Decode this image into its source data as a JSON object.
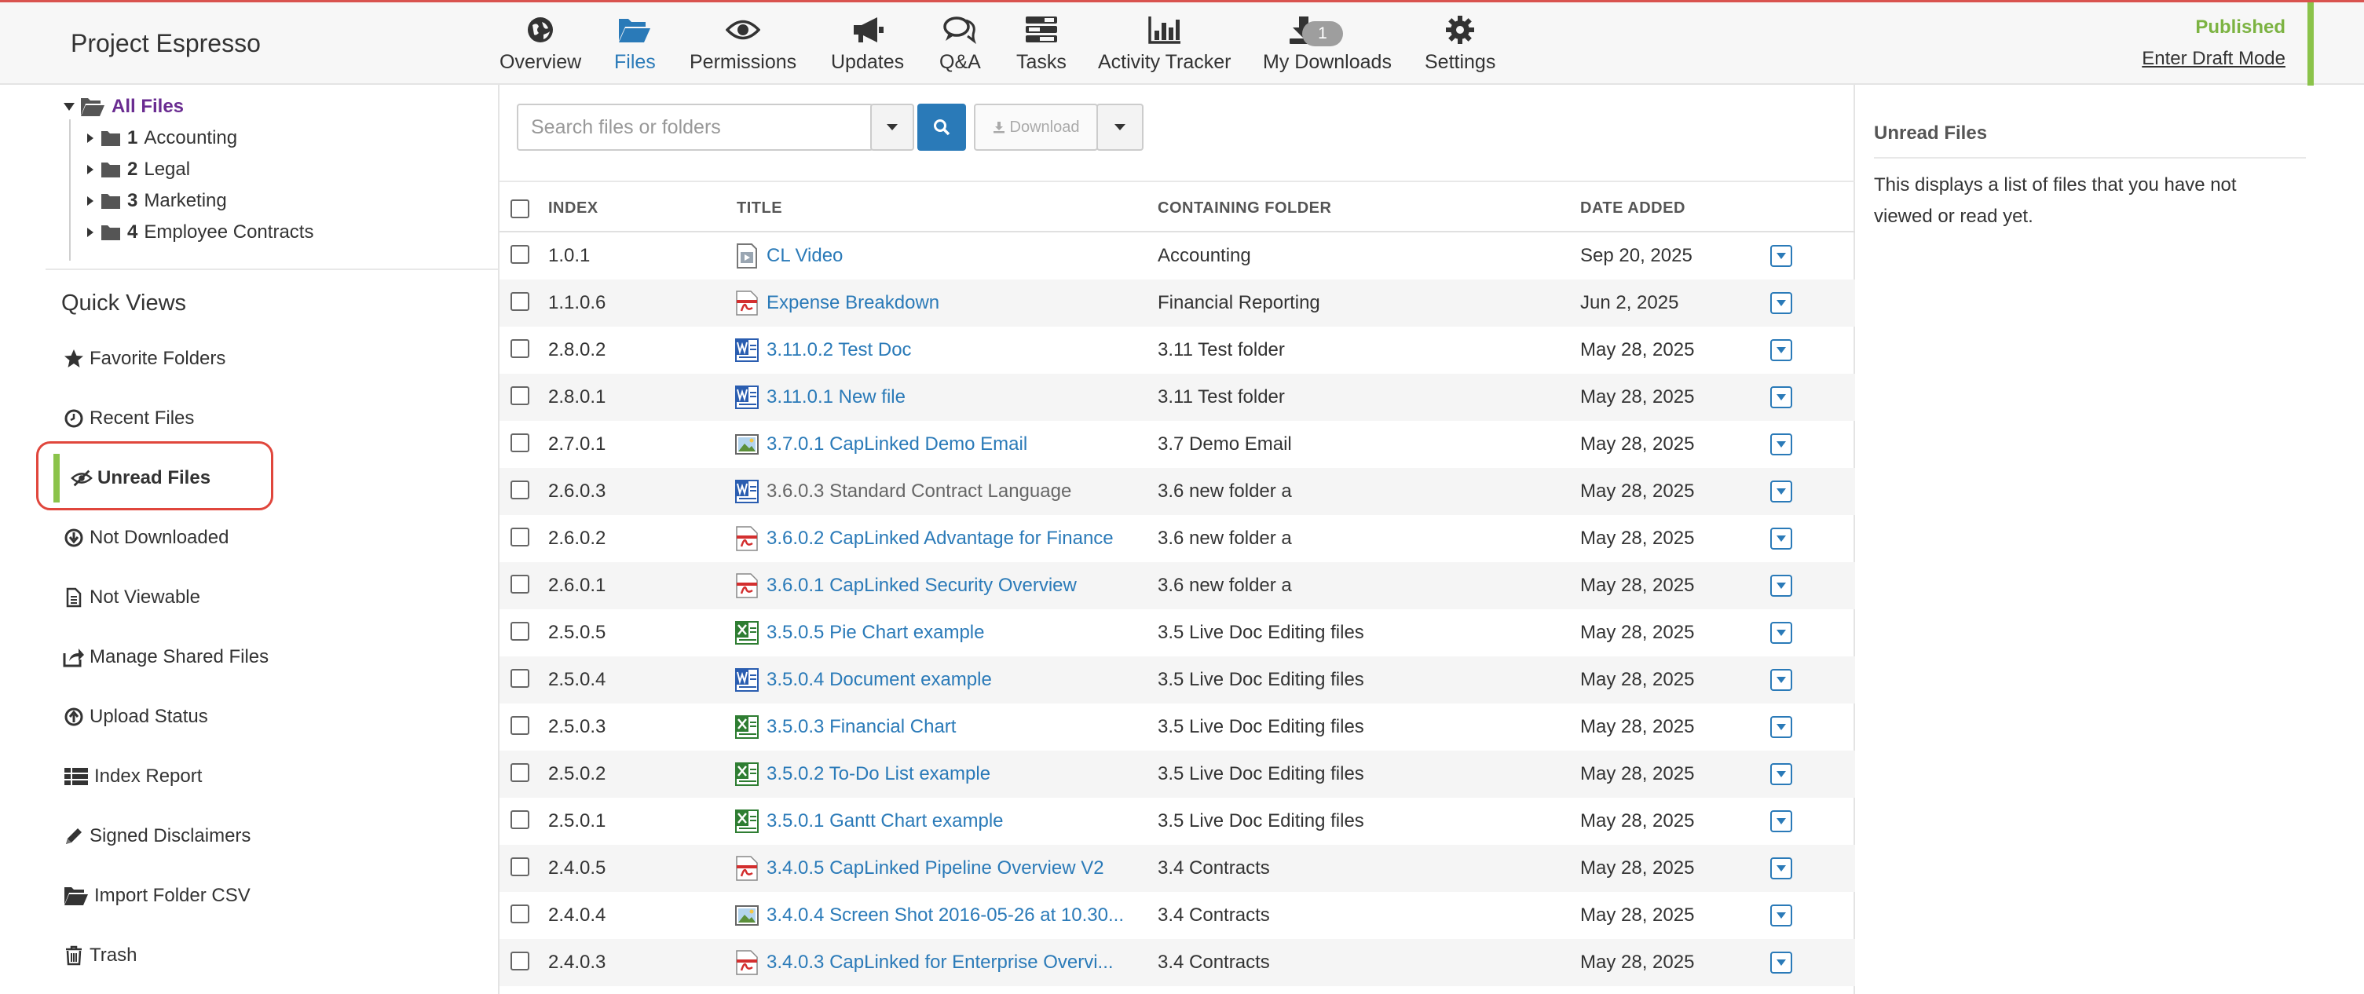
{
  "header": {
    "project_title": "Project Espresso",
    "nav": [
      {
        "label": "Overview",
        "icon": "globe-icon"
      },
      {
        "label": "Files",
        "icon": "folder-open-icon"
      },
      {
        "label": "Permissions",
        "icon": "eye-icon"
      },
      {
        "label": "Updates",
        "icon": "megaphone-icon"
      },
      {
        "label": "Q&A",
        "icon": "chat-icon"
      },
      {
        "label": "Tasks",
        "icon": "tasks-icon"
      },
      {
        "label": "Activity Tracker",
        "icon": "bar-chart-icon"
      },
      {
        "label": "My Downloads",
        "icon": "download-icon",
        "badge": "1"
      },
      {
        "label": "Settings",
        "icon": "gear-icon"
      }
    ],
    "active_nav": "Files",
    "status": "Published",
    "draft_link": "Enter Draft Mode",
    "colors": {
      "accent": "#2a7ab8",
      "published": "#7cb342",
      "top_border": "#d9534f"
    }
  },
  "tree": {
    "root": "All Files",
    "folders": [
      {
        "num": "1",
        "name": "Accounting"
      },
      {
        "num": "2",
        "name": "Legal"
      },
      {
        "num": "3",
        "name": "Marketing"
      },
      {
        "num": "4",
        "name": "Employee Contracts"
      }
    ]
  },
  "quick_views": {
    "title": "Quick Views",
    "items": [
      {
        "label": "Favorite Folders",
        "icon": "star-icon"
      },
      {
        "label": "Recent Files",
        "icon": "clock-icon"
      },
      {
        "label": "Unread Files",
        "icon": "eye-slash-icon"
      },
      {
        "label": "Not Downloaded",
        "icon": "download-circle-icon"
      },
      {
        "label": "Not Viewable",
        "icon": "file-icon"
      },
      {
        "label": "Manage Shared Files",
        "icon": "share-icon"
      },
      {
        "label": "Upload Status",
        "icon": "upload-circle-icon"
      },
      {
        "label": "Index Report",
        "icon": "list-icon"
      },
      {
        "label": "Signed Disclaimers",
        "icon": "pencil-icon"
      },
      {
        "label": "Import Folder CSV",
        "icon": "folder-open-icon"
      },
      {
        "label": "Trash",
        "icon": "trash-icon"
      }
    ],
    "active": "Unread Files"
  },
  "toolbar": {
    "search_placeholder": "Search files or folders",
    "download_label": "Download"
  },
  "table": {
    "headers": {
      "index": "INDEX",
      "title": "TITLE",
      "folder": "CONTAINING FOLDER",
      "date": "DATE ADDED"
    },
    "rows": [
      {
        "index": "1.0.1",
        "title": "CL Video",
        "type": "video",
        "folder": "Accounting",
        "date": "Sep 20, 2025"
      },
      {
        "index": "1.1.0.6",
        "title": "Expense Breakdown",
        "type": "pdf",
        "folder": "Financial Reporting",
        "date": "Jun 2, 2025"
      },
      {
        "index": "2.8.0.2",
        "title": "3.11.0.2 Test Doc",
        "type": "word",
        "folder": "3.11 Test folder",
        "date": "May 28, 2025"
      },
      {
        "index": "2.8.0.1",
        "title": "3.11.0.1 New file",
        "type": "word",
        "folder": "3.11 Test folder",
        "date": "May 28, 2025"
      },
      {
        "index": "2.7.0.1",
        "title": "3.7.0.1 CapLinked Demo Email",
        "type": "image",
        "folder": "3.7 Demo Email",
        "date": "May 28, 2025"
      },
      {
        "index": "2.6.0.3",
        "title": "3.6.0.3 Standard Contract Language",
        "type": "word",
        "folder": "3.6 new folder a",
        "date": "May 28, 2025",
        "gray": true
      },
      {
        "index": "2.6.0.2",
        "title": "3.6.0.2 CapLinked Advantage for Finance",
        "type": "pdf",
        "folder": "3.6 new folder a",
        "date": "May 28, 2025"
      },
      {
        "index": "2.6.0.1",
        "title": "3.6.0.1 CapLinked Security Overview",
        "type": "pdf",
        "folder": "3.6 new folder a",
        "date": "May 28, 2025"
      },
      {
        "index": "2.5.0.5",
        "title": "3.5.0.5 Pie Chart example",
        "type": "excel",
        "folder": "3.5 Live Doc Editing files",
        "date": "May 28, 2025"
      },
      {
        "index": "2.5.0.4",
        "title": "3.5.0.4 Document example",
        "type": "word",
        "folder": "3.5 Live Doc Editing files",
        "date": "May 28, 2025"
      },
      {
        "index": "2.5.0.3",
        "title": "3.5.0.3 Financial Chart",
        "type": "excel",
        "folder": "3.5 Live Doc Editing files",
        "date": "May 28, 2025"
      },
      {
        "index": "2.5.0.2",
        "title": "3.5.0.2 To-Do List example",
        "type": "excel",
        "folder": "3.5 Live Doc Editing files",
        "date": "May 28, 2025"
      },
      {
        "index": "2.5.0.1",
        "title": "3.5.0.1 Gantt Chart example",
        "type": "excel",
        "folder": "3.5 Live Doc Editing files",
        "date": "May 28, 2025"
      },
      {
        "index": "2.4.0.5",
        "title": "3.4.0.5 CapLinked Pipeline Overview V2",
        "type": "pdf",
        "folder": "3.4 Contracts",
        "date": "May 28, 2025"
      },
      {
        "index": "2.4.0.4",
        "title": "3.4.0.4 Screen Shot 2016-05-26 at 10.30...",
        "type": "image",
        "folder": "3.4 Contracts",
        "date": "May 28, 2025"
      },
      {
        "index": "2.4.0.3",
        "title": "3.4.0.3 CapLinked for Enterprise Overvi...",
        "type": "pdf",
        "folder": "3.4 Contracts",
        "date": "May 28, 2025"
      }
    ]
  },
  "info_panel": {
    "title": "Unread Files",
    "text": "This displays a list of files that you have not viewed or read yet."
  }
}
